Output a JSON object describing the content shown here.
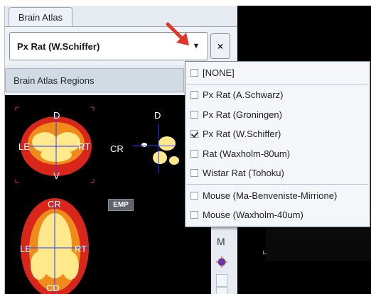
{
  "tab": {
    "label": "Brain Atlas"
  },
  "atlas_combo": {
    "selected": "Px Rat (W.Schiffer)",
    "dropdown_arrow": "chevron-down-icon",
    "close_label": "×"
  },
  "regions": {
    "label": "Brain Atlas Regions"
  },
  "viewer": {
    "coronal": {
      "top": "D",
      "bottom": "V",
      "left": "LE",
      "right": "RT"
    },
    "sagittal": {
      "top": "D",
      "left": "CR"
    },
    "axial": {
      "top": "CR",
      "bottom": "CD",
      "left": "LE",
      "right": "RT"
    },
    "badge": "EMP"
  },
  "side_tools": {
    "m_label": "M",
    "target_icon": "crosshair-icon"
  },
  "dropdown": {
    "group1": [
      {
        "label": "[NONE]",
        "checked": false
      }
    ],
    "group2": [
      {
        "label": "Px Rat (A.Schwarz)",
        "checked": false
      },
      {
        "label": "Px Rat (Groningen)",
        "checked": false
      },
      {
        "label": "Px Rat (W.Schiffer)",
        "checked": true
      },
      {
        "label": "Rat (Waxholm-80um)",
        "checked": false
      },
      {
        "label": "Wistar Rat (Tohoku)",
        "checked": false
      }
    ],
    "group3": [
      {
        "label": "Mouse (Ma-Benveniste-Mirrione)",
        "checked": false
      },
      {
        "label": "Mouse (Waxholm-40um)",
        "checked": false
      }
    ]
  },
  "colors": {
    "accent_red": "#e3362b",
    "brain_red": "#d8261b",
    "brain_orange": "#f08a1a",
    "brain_yellow": "#ffe98a",
    "axis_blue": "#2a3cff"
  }
}
